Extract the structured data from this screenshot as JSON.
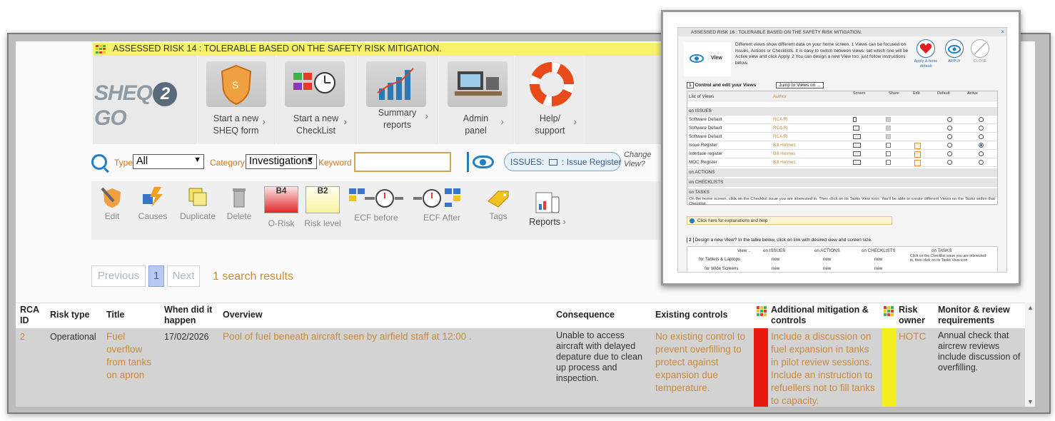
{
  "main": {
    "banner_title": "ASSESSED RISK 14 : TOLERABLE BASED ON THE SAFETY RISK MITIGATION.",
    "logo_text_left": "SHEQ",
    "logo_text_mid": "2",
    "logo_text_right": "GO",
    "nav_tiles": [
      {
        "line1": "Start a new",
        "line2": "SHEQ form"
      },
      {
        "line1": "Start a new",
        "line2": "CheckList"
      },
      {
        "line1": "Summary",
        "line2": "reports"
      },
      {
        "line1": "Admin",
        "line2": "panel"
      },
      {
        "line1": "Help/",
        "line2": "support"
      }
    ],
    "filters": {
      "type_label": "Type",
      "type_value": "All",
      "category_label": "Category",
      "category_value": "Investigations",
      "keyword_label": "Keyword",
      "keyword_value": ""
    },
    "view": {
      "issues_prefix": "ISSUES:",
      "issues_view": ": Issue Register",
      "change_view_line1": "Change",
      "change_view_line2": "View?"
    },
    "toolbar": {
      "edit": "Edit",
      "causes": "Causes",
      "duplicate": "Duplicate",
      "delete": "Delete",
      "o_risk_code": "B4",
      "o_risk_label": "O-Risk",
      "risk_level_code": "B2",
      "risk_level_label": "Risk level",
      "ecf_before": "ECF before",
      "ecf_after": "ECF After",
      "tags": "Tags",
      "reports": "Reports"
    },
    "pager": {
      "previous": "Previous",
      "current": "1",
      "next": "Next",
      "results": "1 search results"
    },
    "table": {
      "headers": {
        "rca_id": "RCA ID",
        "risk_type": "Risk type",
        "title": "Title",
        "when": "When did it happen",
        "overview": "Overview",
        "consequence": "Consequence",
        "existing_controls": "Existing controls",
        "additional_mitigation": "Additional mitigation & controls",
        "risk_owner": "Risk owner",
        "monitor_review": "Monitor & review requirements"
      },
      "row": {
        "rca_id": "2",
        "risk_type": "Operational",
        "title": "Fuel overflow from tanks on apron",
        "when": "17/02/2026",
        "overview": "Pool of fuel beneath aircraft seen by airfield staff at 12:00 .",
        "consequence": "Unable to access aircraft with delayed depature due to clean up process and inspection.",
        "existing_controls": "No existing control to prevent overfilling to protect against expansion due temperature.",
        "additional_mitigation": "Include a discussion on fuel expansion in tanks in pilot review sessions. Include an instruction to refuellers not to fill tanks to capacity.",
        "risk_owner": "HOTC",
        "monitor_review": "Annual check that aircrew reviews include discussion of overfilling."
      }
    },
    "colors": {
      "accent_blue": "#1f7fc8",
      "orange_text": "#c98a3a",
      "mitigation_bar": "#e81a10",
      "owner_bar": "#f2ee20",
      "banner_yellow": "#f6f36a"
    }
  },
  "inset": {
    "title": "ASSESSED RISK 16 : TOLERABLE BASED ON THE SAFETY RISK MITIGATION.",
    "view_label": "View",
    "description": "Different views show different data on your home screen. 1 Views can be focused on Issues, Actions or Checklists. It is easy to switch between views: set which one will be Active view and click Apply. 2 You can design a new View too: just follow instructions below.",
    "buttons": {
      "apply_default": "Apply & force default",
      "apply": "APPLY",
      "close": "CLOSE"
    },
    "section1": "Control and edit your Views",
    "jump_to": "Jump to Views on ...",
    "cols": {
      "list": "List of Views",
      "author": "Author",
      "screen": "Screen",
      "share": "Share",
      "edit": "Edit",
      "default": "Default",
      "active": "Active"
    },
    "groups": {
      "issues": "on ISSUES",
      "actions": "on ACTIONS",
      "checklists": "on CHECKLISTS",
      "tasks": "on TASKS"
    },
    "rows": [
      {
        "name": "Software Default",
        "author": "RCA Rl"
      },
      {
        "name": "Software Default",
        "author": "RCA Rl"
      },
      {
        "name": "Software Default",
        "author": "RCA Rl"
      },
      {
        "name": "Issue Register",
        "author": "Bill Holmes"
      },
      {
        "name": "Interface register",
        "author": "Bill Holmes"
      },
      {
        "name": "MOC Register",
        "author": "Bill Holmes"
      }
    ],
    "tasks_text": "On the home screen, click on the Checklist issue you are interested in. Then click on its Tasks View icon: You'll be able to create different Views on the Tasks within that Checklist.",
    "help": "Click here for explanations and help",
    "section2": "Design a new View? In the table below, click on link with desired view and screen size.",
    "design": {
      "view": "View ..",
      "on_issues": "on ISSUES",
      "on_actions": "on ACTIONS",
      "on_checklists": "on CHECKLISTS",
      "on_tasks": "on TASKS",
      "tablets": "for Tablets & Laptops",
      "wide": "for Wide Screens",
      "new": "new",
      "tasks_note": "Click on the Checklist issue you are interested in, then click on its Tasks View icon"
    }
  }
}
